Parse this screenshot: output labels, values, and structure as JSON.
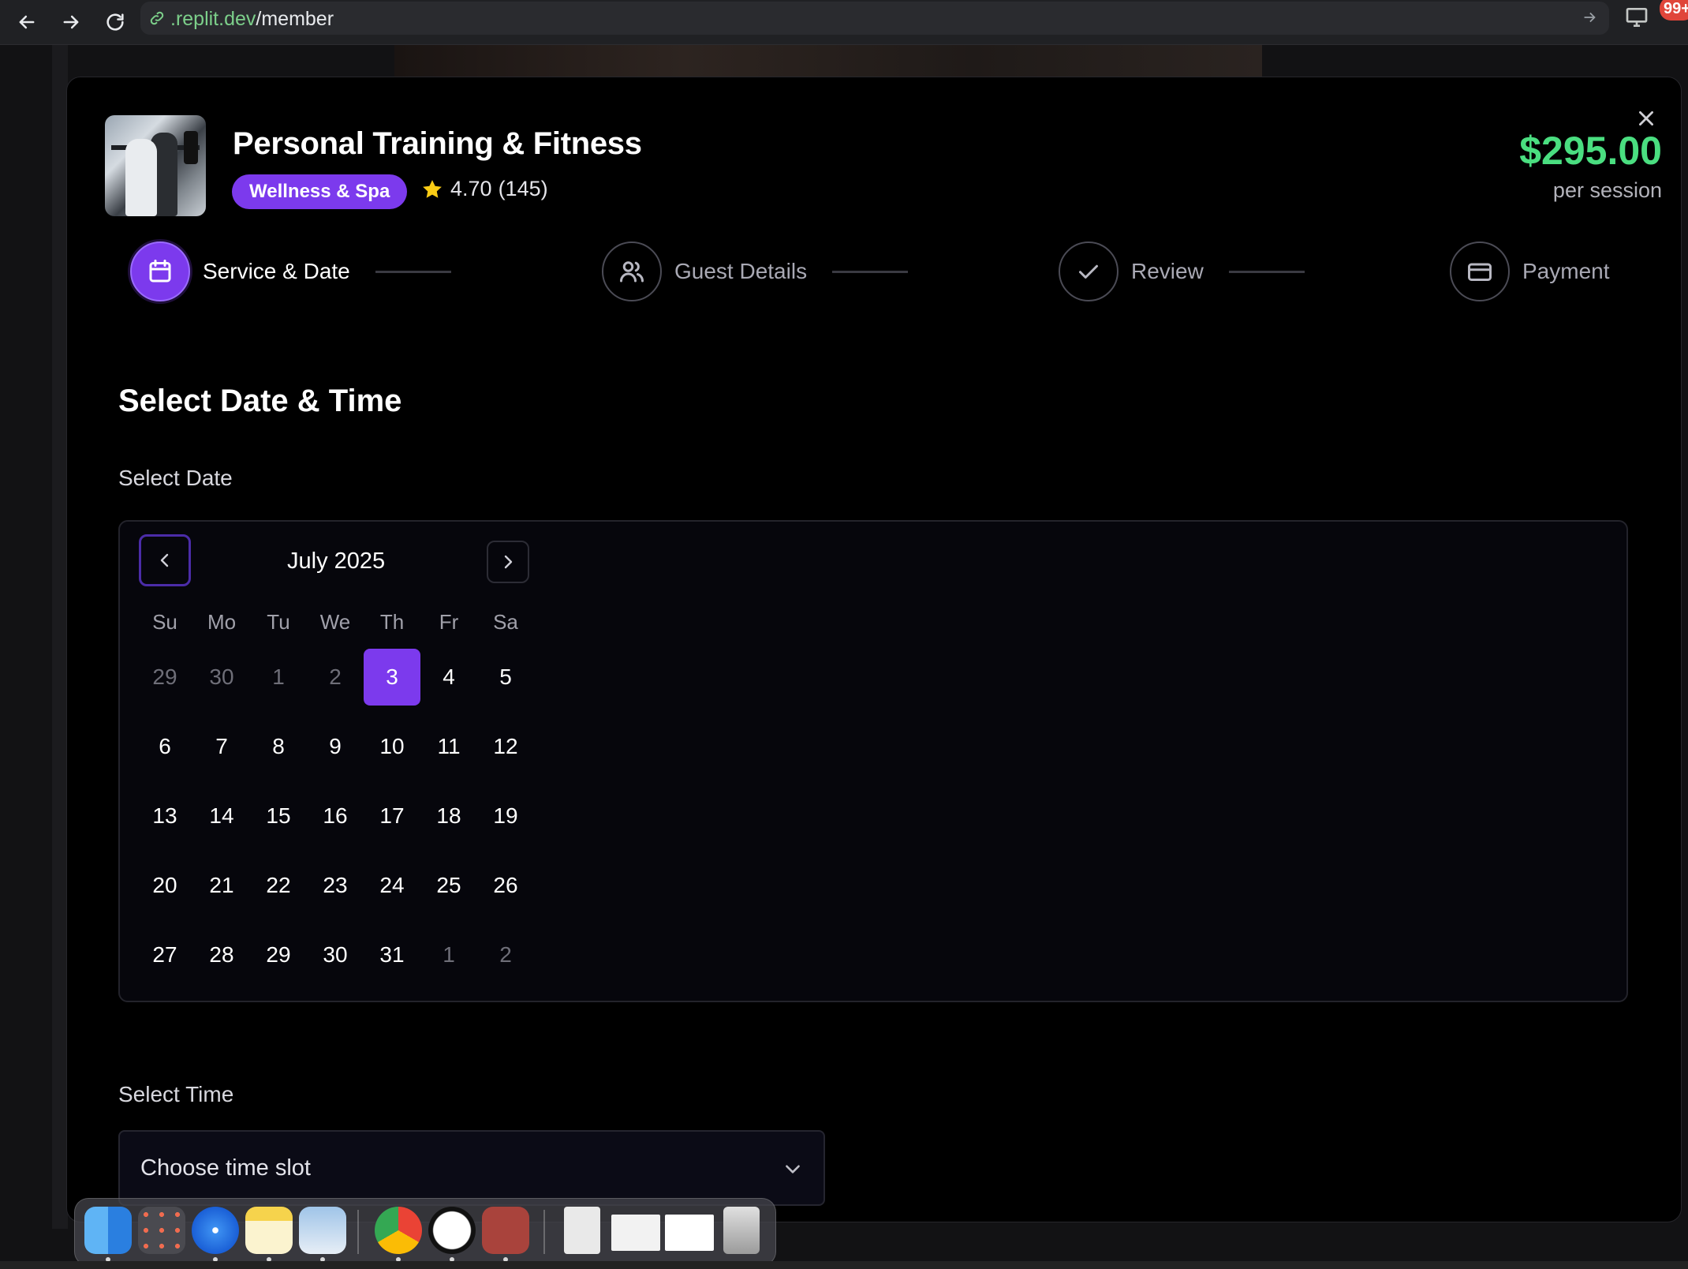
{
  "browser": {
    "url_prefix": ".replit.dev",
    "url_path": "/member",
    "notification_count": "99+"
  },
  "service": {
    "title": "Personal Training & Fitness",
    "category": "Wellness & Spa",
    "rating": "4.70",
    "reviews": "(145)",
    "price": "$295.00",
    "price_unit": "per session"
  },
  "steps": [
    {
      "label": "Service & Date",
      "icon": "calendar-icon",
      "active": true
    },
    {
      "label": "Guest Details",
      "icon": "users-icon",
      "active": false
    },
    {
      "label": "Review",
      "icon": "check-icon",
      "active": false
    },
    {
      "label": "Payment",
      "icon": "credit-card-icon",
      "active": false
    }
  ],
  "section_title": "Select Date & Time",
  "date_label": "Select Date",
  "calendar": {
    "month": "July 2025",
    "weekdays": [
      "Su",
      "Mo",
      "Tu",
      "We",
      "Th",
      "Fr",
      "Sa"
    ],
    "weeks": [
      [
        "29",
        "30",
        "1",
        "2",
        "3",
        "4",
        "5"
      ],
      [
        "6",
        "7",
        "8",
        "9",
        "10",
        "11",
        "12"
      ],
      [
        "13",
        "14",
        "15",
        "16",
        "17",
        "18",
        "19"
      ],
      [
        "20",
        "21",
        "22",
        "23",
        "24",
        "25",
        "26"
      ],
      [
        "27",
        "28",
        "29",
        "30",
        "31",
        "1",
        "2"
      ]
    ],
    "selected": "3"
  },
  "time_label": "Select Time",
  "time_select": {
    "value": "Choose time slot"
  },
  "colors": {
    "accent": "#7c3aed",
    "price": "#4ade80"
  },
  "dock": {
    "apps": [
      "finder-icon",
      "launchpad-icon",
      "safari-icon",
      "notes-icon",
      "preview-icon",
      "chrome-icon",
      "clock-icon",
      "dictionary-icon",
      "txt-file-icon",
      "window-thumb-icon",
      "window-thumb-icon",
      "trash-icon"
    ]
  }
}
